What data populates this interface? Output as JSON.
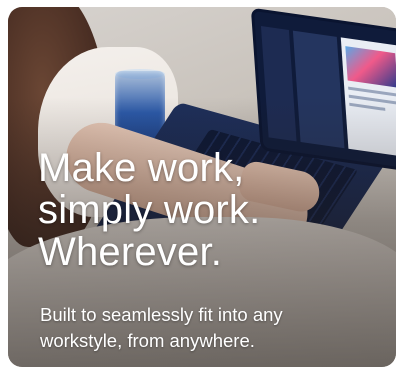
{
  "promo": {
    "headline_lines": [
      "Make work,",
      "simply work.",
      "Wherever."
    ],
    "subtext_lines": [
      "Built to seamlessly fit into any",
      "workstyle, from anywhere."
    ]
  },
  "colors": {
    "text": "#ffffff",
    "laptop": "#142246"
  }
}
